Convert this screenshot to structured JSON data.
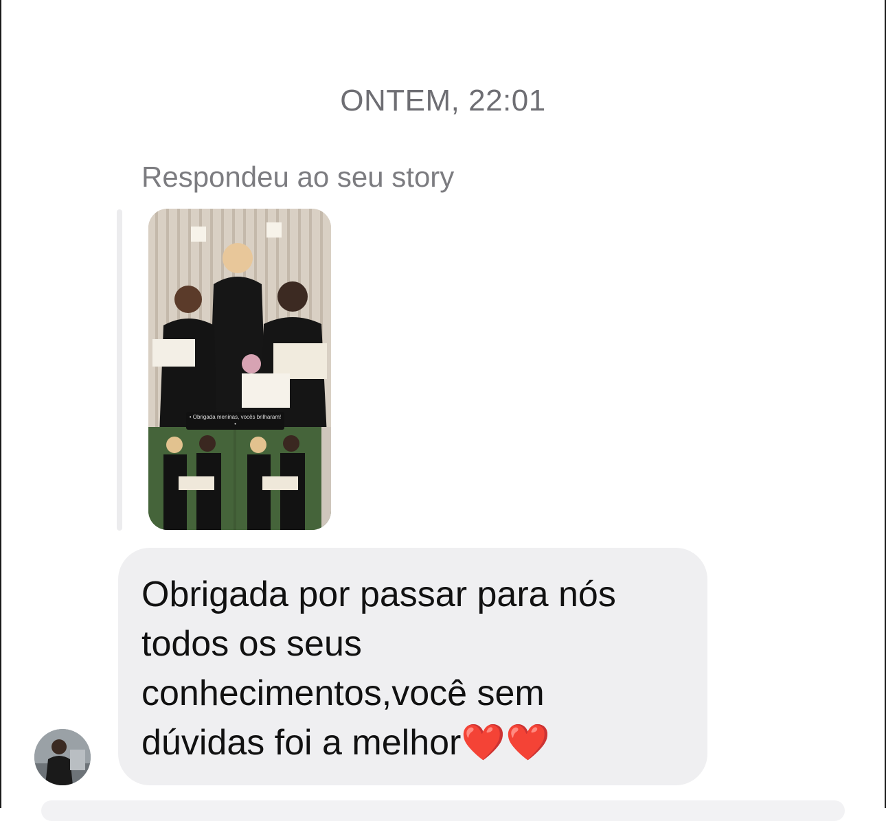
{
  "chat": {
    "timestamp": "ONTEM, 22:01",
    "reply_label": "Respondeu ao seu story",
    "story": {
      "caption": "• Obrigada meninas, vocês brilharam! •"
    },
    "message": {
      "text": "Obrigada por passar para nós todos os seus conhecimentos,você sem dúvidas foi a melhor❤️❤️"
    }
  },
  "colors": {
    "bubble": "#efeff1",
    "timestamp": "#6e6e73",
    "reply_label": "#7c7c80",
    "text": "#111111"
  },
  "icons": {
    "avatar": "sender-avatar"
  }
}
